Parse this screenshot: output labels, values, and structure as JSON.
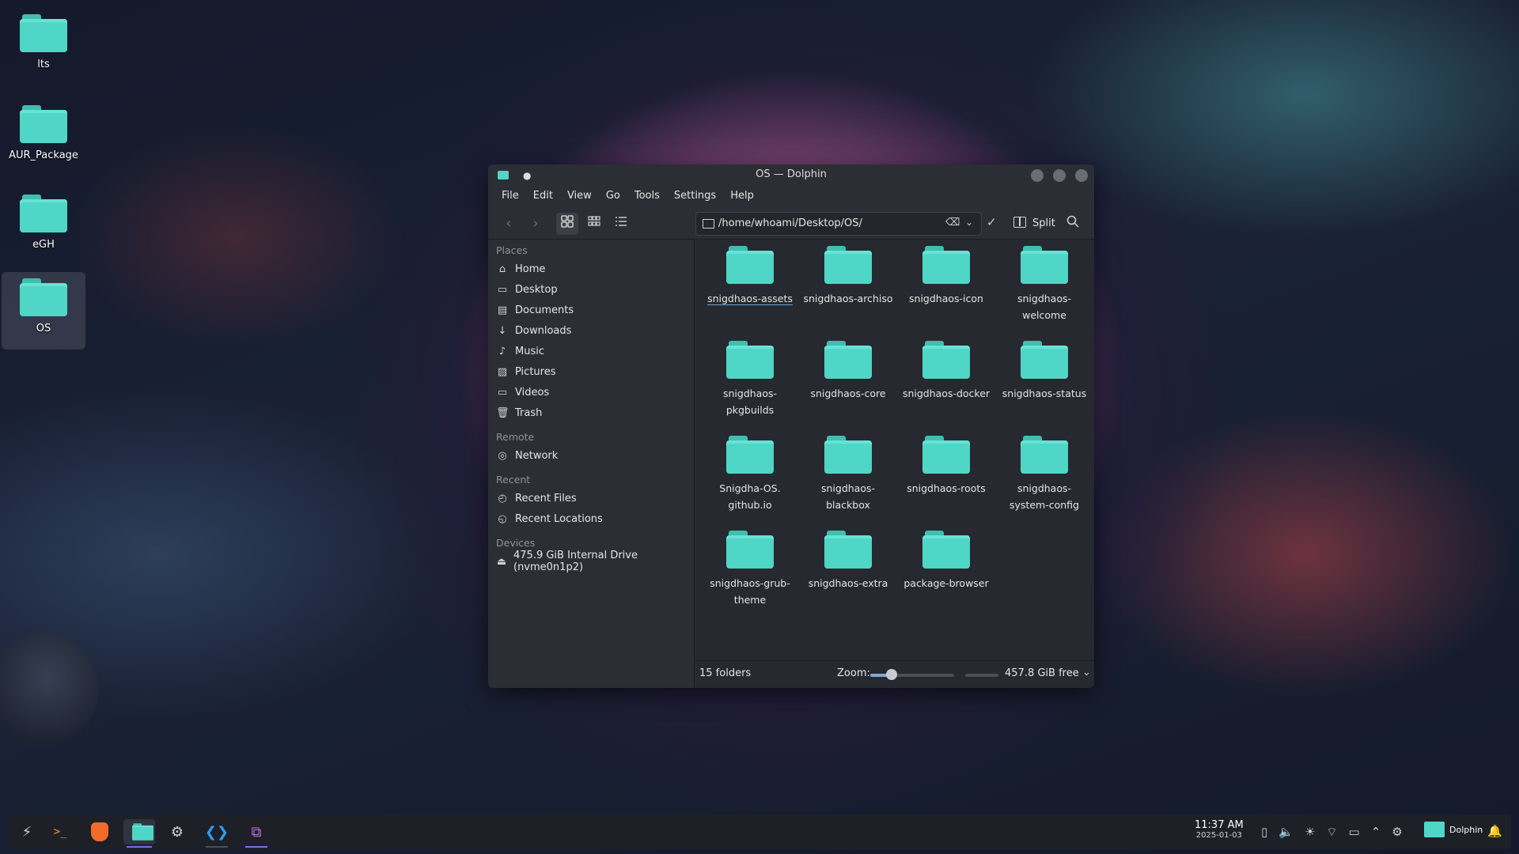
{
  "desktop": {
    "icons": [
      {
        "label": "lts"
      },
      {
        "label": "AUR_Package"
      },
      {
        "label": "eGH"
      },
      {
        "label": "OS"
      }
    ]
  },
  "window": {
    "title": "OS — Dolphin",
    "menu": [
      "File",
      "Edit",
      "View",
      "Go",
      "Tools",
      "Settings",
      "Help"
    ],
    "location": "/home/whoami/Desktop/OS/",
    "split_label": "Split",
    "icons": {
      "back": "arrow-left-icon",
      "forward": "arrow-right-icon",
      "icons_view": "grid-large-icon",
      "compact_view": "grid-small-icon",
      "details_view": "list-icon",
      "clear": "backspace-icon",
      "history": "chevron-down-icon",
      "confirm": "check-icon",
      "split": "split-view-icon",
      "search": "search-icon"
    }
  },
  "sidebar": {
    "places_title": "Places",
    "places": [
      "Home",
      "Desktop",
      "Documents",
      "Downloads",
      "Music",
      "Pictures",
      "Videos",
      "Trash"
    ],
    "remote_title": "Remote",
    "remote": [
      "Network"
    ],
    "recent_title": "Recent",
    "recent": [
      "Recent Files",
      "Recent Locations"
    ],
    "devices_title": "Devices",
    "devices": [
      "475.9 GiB Internal Drive (nvme0n1p2)"
    ]
  },
  "folders": [
    "snigdhaos-assets",
    "snigdhaos-archiso",
    "snigdhaos-icon",
    "snigdhaos-welcome",
    "snigdhaos-pkgbuilds",
    "snigdhaos-core",
    "snigdhaos-docker",
    "snigdhaos-status",
    "Snigdha-OS.github.io",
    "snigdhaos-blackbox",
    "snigdhaos-roots",
    "snigdhaos-system-config",
    "snigdhaos-grub-theme",
    "snigdhaos-extra",
    "package-browser"
  ],
  "folders_display": [
    "snigdhaos-assets",
    "snigdhaos-archiso",
    "snigdhaos-icon",
    "snigdhaos-\nwelcome",
    "snigdhaos-\npkgbuilds",
    "snigdhaos-core",
    "snigdhaos-docker",
    "snigdhaos-status",
    "Snigdha-OS.\ngithub.io",
    "snigdhaos-\nblackbox",
    "snigdhaos-roots",
    "snigdhaos-\nsystem-config",
    "snigdhaos-grub-\ntheme",
    "snigdhaos-extra",
    "package-browser"
  ],
  "status": {
    "count": "15 folders",
    "zoom_label": "Zoom:",
    "zoom_level": 0.25,
    "free": "457.8 GiB free"
  },
  "taskbar": {
    "time": "11:37 AM",
    "date": "2025-01-03",
    "active_app": "Dolphin",
    "apps": [
      "launcher-icon",
      "terminal-icon",
      "brave-icon",
      "dolphin-icon",
      "settings-icon",
      "vscode-icon",
      "screenshot-icon"
    ],
    "tray": [
      "clipboard-icon",
      "volume-icon",
      "brightness-icon",
      "wifi-icon",
      "battery-icon",
      "chevron-up-icon",
      "gear-icon"
    ],
    "colors": {
      "accent": "#4fd6c6",
      "indicator": "#7b6ee0"
    }
  }
}
